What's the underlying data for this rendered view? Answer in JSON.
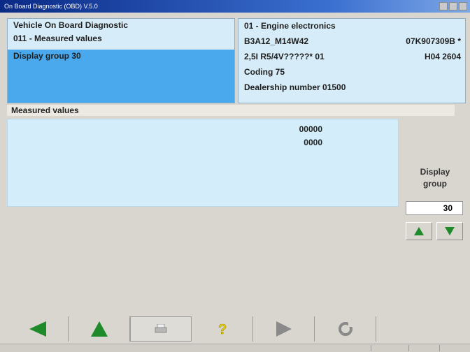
{
  "window": {
    "title": "On Board Diagnostic (OBD) V.5.0"
  },
  "header_left": {
    "line1": "Vehicle On Board Diagnostic",
    "line2": "011 - Measured values",
    "selected": "Display group 30"
  },
  "header_right": {
    "system": "01 - Engine electronics",
    "component": "B3A12_M14W42",
    "part_number": "07K907309B",
    "part_suffix": "*",
    "engine": "2,5I R5/4V?????* 01",
    "version": "H04  2604",
    "coding": "Coding 75",
    "dealership": "Dealership number 01500"
  },
  "measured": {
    "label": "Measured values",
    "values": [
      "00000",
      "0000"
    ]
  },
  "display_group": {
    "label_line1": "Display",
    "label_line2": "group",
    "value": "30"
  },
  "colors": {
    "panel_bg": "#d6ecf8",
    "selected_bg": "#4aa8ec",
    "green_arrow": "#1f8a2a",
    "gray_arrow": "#8a8a8a",
    "help_yellow": "#e9d21a"
  },
  "icons": {
    "back": "left-arrow-icon",
    "up": "up-triangle-icon",
    "print": "printer-icon",
    "help": "question-mark-icon",
    "next": "right-arrow-icon",
    "refresh": "refresh-icon"
  }
}
